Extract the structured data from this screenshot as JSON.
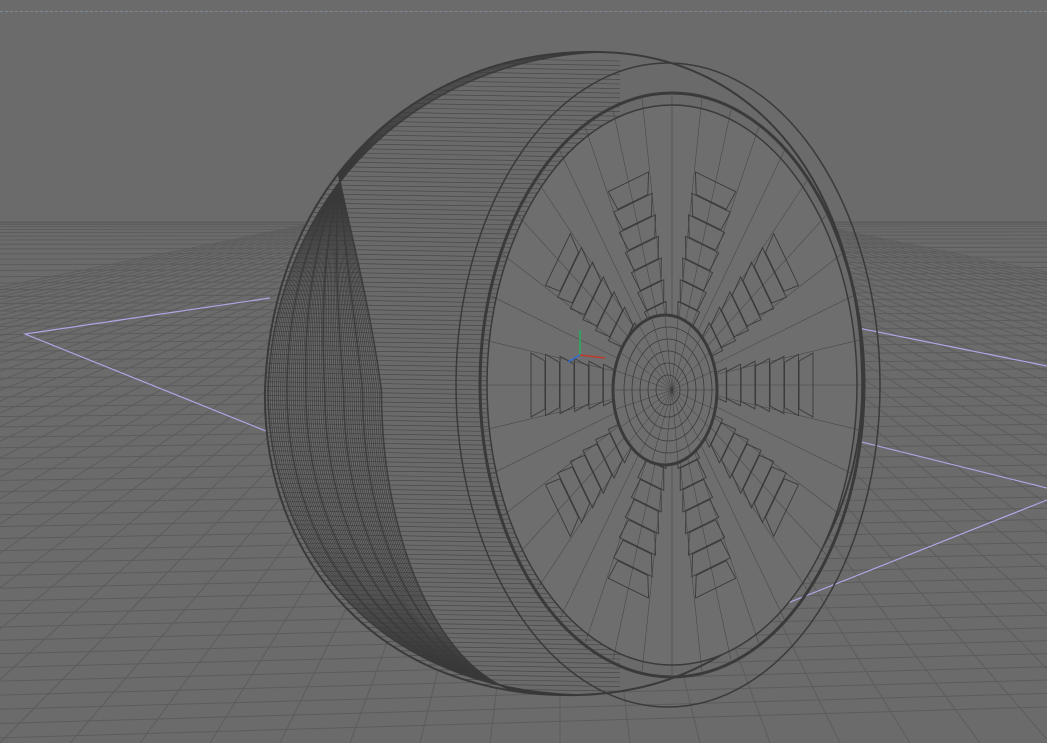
{
  "viewport": {
    "kind": "3d-perspective-viewport",
    "display_mode": "wireframe",
    "background_color": "#6b6b6b",
    "grid_color": "#5c5c5c",
    "wire_color": "#3a3a3a",
    "selection_outline_color": "#b0a6e6",
    "axis_colors": {
      "x": "#c0392b",
      "y": "#27ae60",
      "z": "#2f6fd6"
    }
  },
  "scene": {
    "object": "tire-wheel-mesh",
    "components": [
      "tire",
      "rim",
      "spokes",
      "hub"
    ],
    "grid_visible": true,
    "bounding_box_visible": true,
    "pivot_gizmo_visible": true
  },
  "icons": {
    "pivot": "axis-gizmo-icon"
  }
}
